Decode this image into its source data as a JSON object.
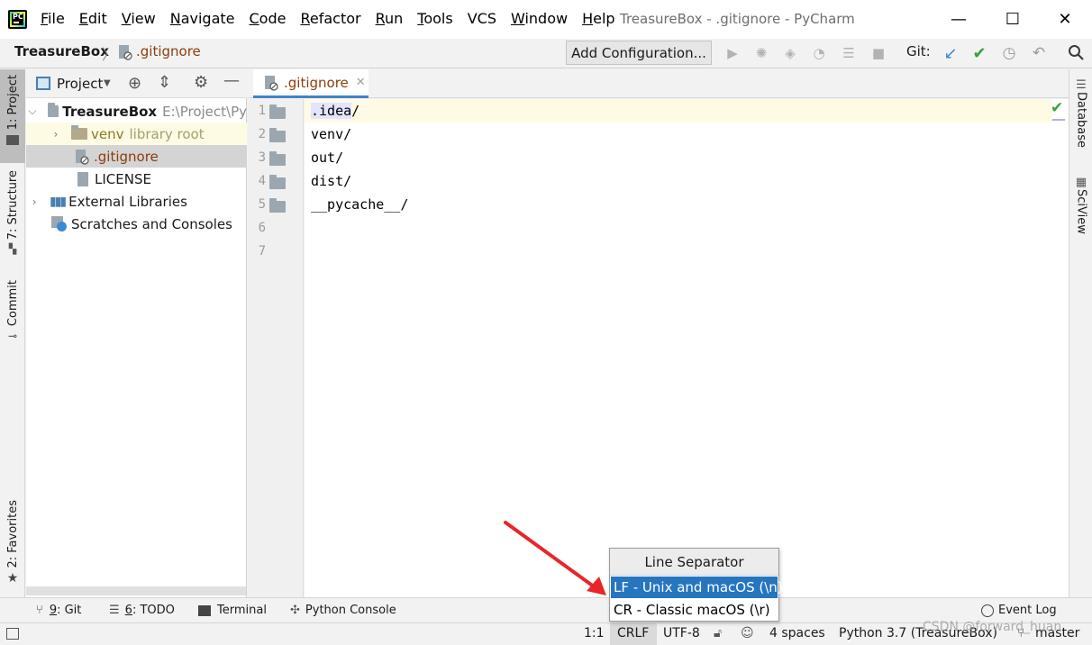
{
  "window": {
    "title": "TreasureBox - .gitignore - PyCharm",
    "minimize": "—",
    "maximize": "☐",
    "close": "✕"
  },
  "menu": [
    {
      "u": "F",
      "rest": "ile"
    },
    {
      "u": "E",
      "rest": "dit"
    },
    {
      "u": "V",
      "rest": "iew"
    },
    {
      "u": "N",
      "rest": "avigate"
    },
    {
      "u": "C",
      "rest": "ode"
    },
    {
      "u": "R",
      "rest": "efactor"
    },
    {
      "u": "R",
      "rest": "un"
    },
    {
      "u": "T",
      "rest": "ools"
    },
    {
      "u": "",
      "rest": "VCS"
    },
    {
      "u": "W",
      "rest": "indow"
    },
    {
      "u": "H",
      "rest": "elp"
    }
  ],
  "nav": {
    "project": "TreasureBox",
    "file": ".gitignore",
    "add_configuration": "Add Configuration...",
    "git_label": "Git:"
  },
  "left_tabs": {
    "project": "1: Project",
    "structure": "7: Structure",
    "commit": "Commit",
    "favorites": "2: Favorites"
  },
  "right_tabs": {
    "database": "Database",
    "sciview": "SciView"
  },
  "project_panel": {
    "title": "Project",
    "tree": [
      {
        "name": "TreasureBox",
        "extra": "E:\\Project\\Py"
      },
      {
        "name": "venv",
        "extra": "library root"
      },
      {
        "name": ".gitignore"
      },
      {
        "name": "LICENSE"
      },
      {
        "name": "External Libraries"
      },
      {
        "name": "Scratches and Consoles"
      }
    ]
  },
  "editor": {
    "tab_label": ".gitignore",
    "line_numbers": [
      "1",
      "2",
      "3",
      "4",
      "5",
      "6",
      "7"
    ],
    "lines": [
      ".idea/",
      "venv/",
      "out/",
      "dist/",
      "__pycache__/",
      "",
      ""
    ],
    "line1_highlight": ".idea",
    "line1_rest": "/"
  },
  "tool_windows": {
    "git": {
      "num": "9",
      "label": ": Git"
    },
    "todo": {
      "num": "6",
      "label": ": TODO"
    },
    "terminal": "Terminal",
    "python_console": "Python Console",
    "event_log": "Event Log"
  },
  "status": {
    "position": "1:1",
    "line_separator": "CRLF",
    "encoding": "UTF-8",
    "indent": "4 spaces",
    "interpreter": "Python 3.7 (TreasureBox)",
    "branch": "master"
  },
  "popup": {
    "title": "Line Separator",
    "options": [
      "LF - Unix and macOS (\\n)",
      "CR - Classic macOS (\\r)"
    ]
  },
  "watermark": "CSDN @forward_huan",
  "colors": {
    "accent": "#2675bf",
    "annotation_arrow": "#e8262a",
    "file_ignored": "#8b3d0a",
    "check_green": "#3e9e3e",
    "git_blue": "#3c8ad7"
  }
}
